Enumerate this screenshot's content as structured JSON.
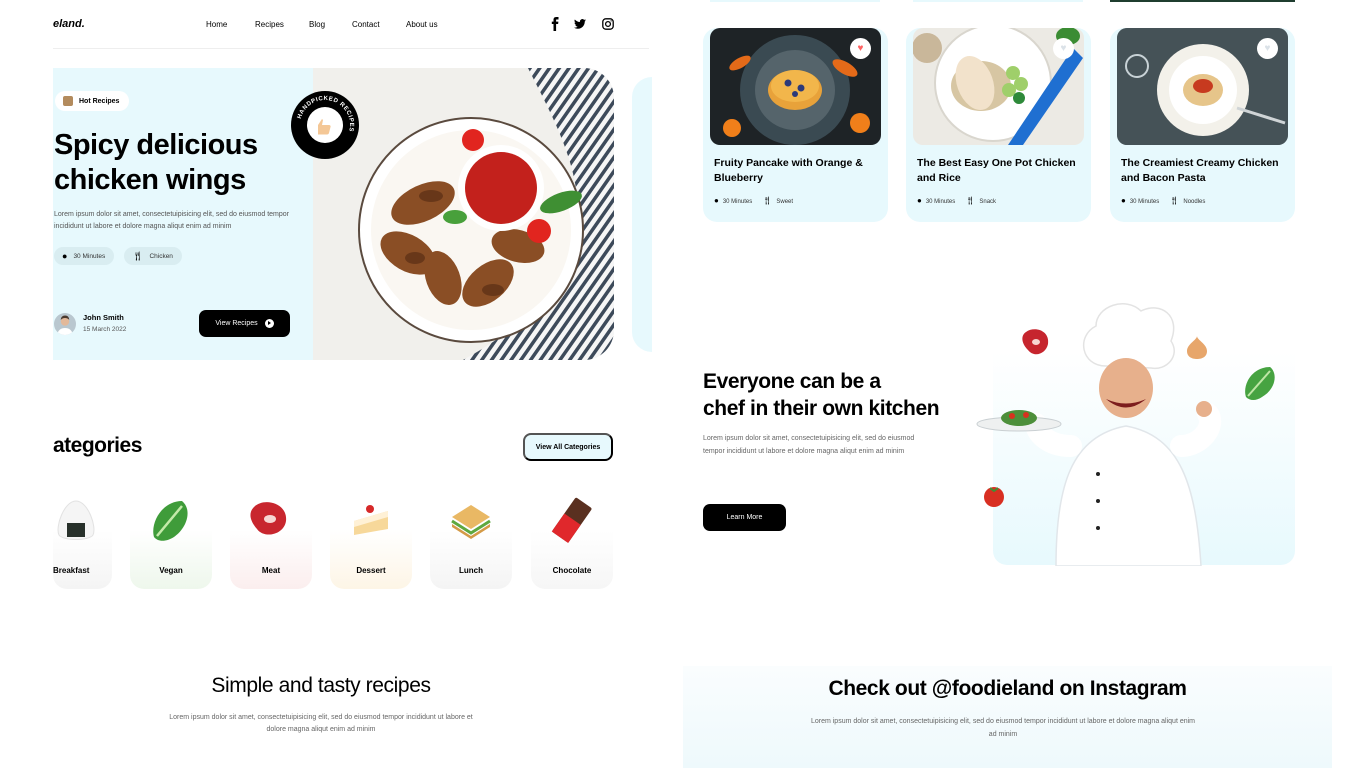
{
  "brand": {
    "logo_text": "eland."
  },
  "nav": {
    "items": [
      "Home",
      "Recipes",
      "Blog",
      "Contact",
      "About us"
    ],
    "social": [
      "facebook-icon",
      "twitter-icon",
      "instagram-icon"
    ]
  },
  "hero": {
    "badge": "Hot Recipes",
    "title_line1": "Spicy delicious",
    "title_line2": "chicken wings",
    "description": "Lorem ipsum dolor sit amet, consectetuipisicing elit, sed do eiusmod tempor incididunt ut labore et dolore magna aliqut enim ad minim",
    "time": "30 Minutes",
    "category": "Chicken",
    "author": "John Smith",
    "date": "15 March 2022",
    "button": "View Recipes",
    "stamp_text": "HANDPICKED RECIPES"
  },
  "categories": {
    "title": "ategories",
    "view_all": "View All Categories",
    "items": [
      {
        "label": "Breakfast",
        "icon": "onigiri-icon",
        "color": "#f4f4f4"
      },
      {
        "label": "Vegan",
        "icon": "lettuce-icon",
        "color": "#eef7ec"
      },
      {
        "label": "Meat",
        "icon": "steak-icon",
        "color": "#fbeeee"
      },
      {
        "label": "Dessert",
        "icon": "cake-icon",
        "color": "#fdf5e6"
      },
      {
        "label": "Lunch",
        "icon": "sandwich-icon",
        "color": "#f4f4f4"
      },
      {
        "label": "Chocolate",
        "icon": "chocolate-icon",
        "color": "#f6f6f6"
      }
    ]
  },
  "simple_section": {
    "title": "Simple and tasty recipes",
    "description": "Lorem ipsum dolor sit amet, consectetuipisicing elit, sed do eiusmod tempor incididunt ut labore et dolore magna aliqut enim ad minim"
  },
  "recipe_cards": [
    {
      "title": "Fruity Pancake with Orange & Blueberry",
      "time": "30 Minutes",
      "tag": "Sweet",
      "liked": true
    },
    {
      "title": "The Best Easy One Pot Chicken and Rice",
      "time": "30 Minutes",
      "tag": "Snack",
      "liked": false
    },
    {
      "title": "The Creamiest Creamy Chicken and Bacon Pasta",
      "time": "30 Minutes",
      "tag": "Noodles",
      "liked": false
    }
  ],
  "chef_section": {
    "title_line1": "Everyone can be a",
    "title_line2": "chef in their own kitchen",
    "description": "Lorem ipsum dolor sit amet, consectetuipisicing elit, sed do eiusmod tempor incididunt ut labore et dolore magna aliqut enim ad minim",
    "button": "Learn More"
  },
  "instagram_section": {
    "title": "Check out @foodieland on Instagram",
    "description": "Lorem ipsum dolor sit amet, consectetuipisicing elit, sed do eiusmod tempor incididunt ut labore et dolore magna aliqut enim ad minim"
  },
  "colors": {
    "accent_bg": "#e7f9fd",
    "button_dark": "#000000",
    "heart_red": "#ff6363"
  }
}
